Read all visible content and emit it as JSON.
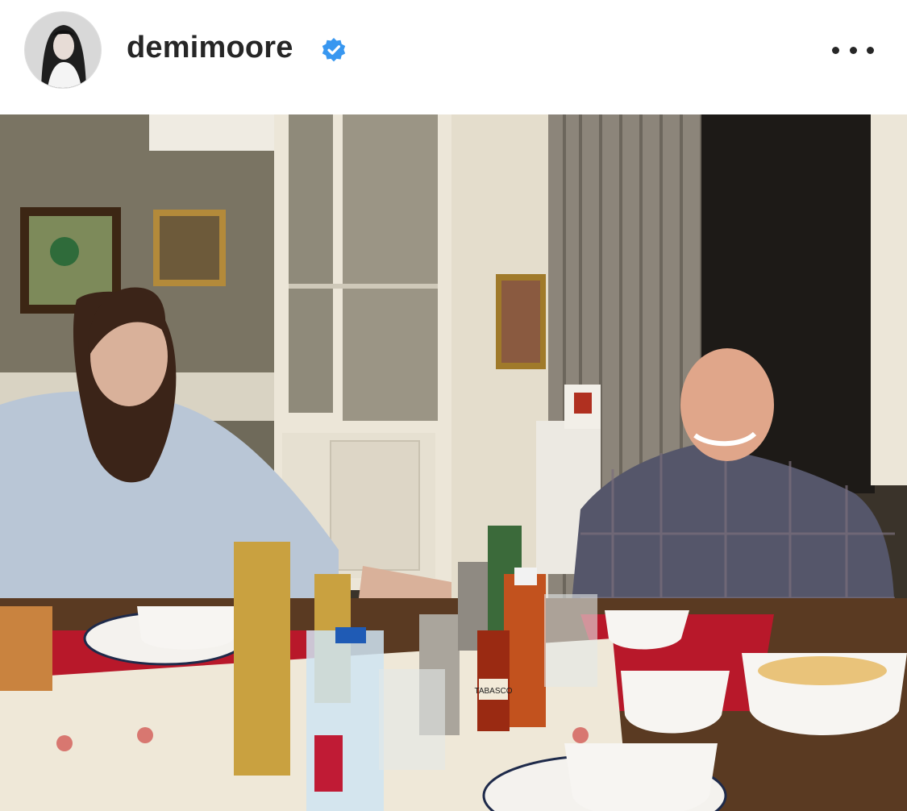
{
  "post": {
    "username": "demimoore",
    "verified": true,
    "icons": {
      "avatar": "profile-avatar-photo",
      "verified": "verified-badge-icon",
      "more": "more-options-icon"
    },
    "colors": {
      "verified_badge": "#3897f0",
      "text": "#262626"
    },
    "media": {
      "type": "photo",
      "bottle_label": "TABASCO"
    }
  }
}
